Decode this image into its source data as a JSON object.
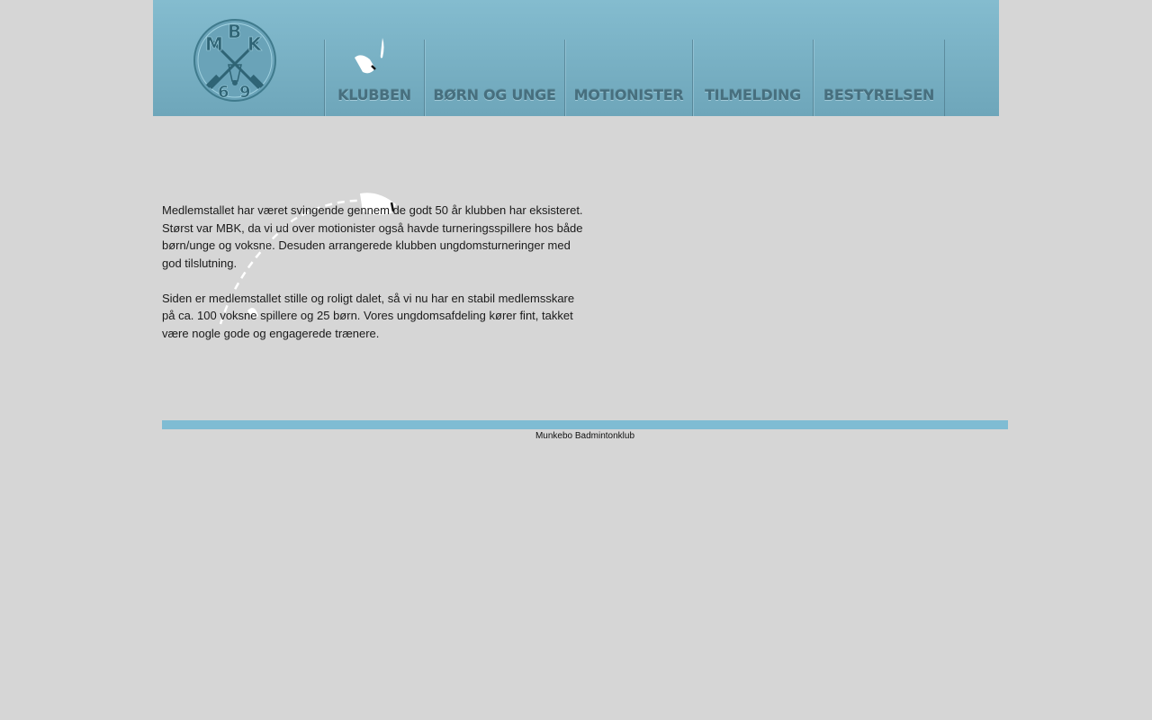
{
  "header": {
    "logo": {
      "letters": [
        "M",
        "B",
        "K",
        "6",
        "9"
      ],
      "icon": "crossed-rackets-shuttlecock-logo"
    },
    "nav": [
      {
        "label": "KLUBBEN",
        "active": true
      },
      {
        "label": "BØRN OG UNGE"
      },
      {
        "label": "MOTIONISTER"
      },
      {
        "label": "TILMELDING"
      },
      {
        "label": "BESTYRELSEN"
      }
    ]
  },
  "main": {
    "paragraphs": [
      "Medlemstallet har været svingende gennem de godt 50 år klubben har eksisteret. Størst var MBK, da vi ud over motionister også havde turneringsspillere hos både børn/unge og voksne. Desuden arrangerede klubben ungdomsturneringer med god tilslutning.",
      "Siden er medlemstallet stille og roligt dalet, så vi nu har en stabil medlemsskare på ca. 100 voksne spillere og 25 børn. Vores ungdomsafdeling kører fint, takket være nogle gode og engagerede trænere."
    ]
  },
  "footer": {
    "text": "Munkebo Badmintonklub"
  },
  "colors": {
    "header_top": "#84bccf",
    "header_bottom": "#6ea6ba",
    "nav_text": "#476f7e",
    "footer_bar": "#7fbcd3",
    "page_bg": "#d6d6d6"
  }
}
